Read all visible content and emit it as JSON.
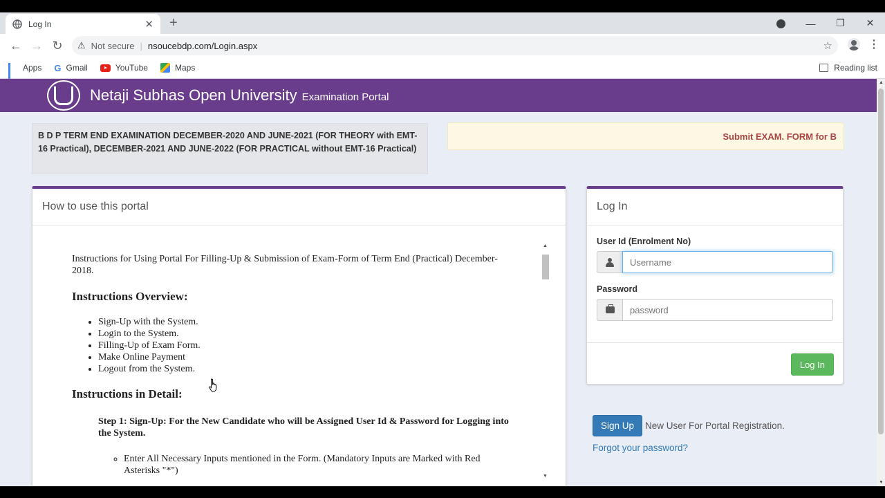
{
  "browser": {
    "tab_title": "Log In",
    "security_label": "Not secure",
    "url": "nsoucebdp.com/Login.aspx",
    "bookmarks": [
      "Apps",
      "Gmail",
      "YouTube",
      "Maps"
    ],
    "reading_list": "Reading list"
  },
  "header": {
    "title": "Netaji Subhas Open University",
    "subtitle": "Examination Portal",
    "brand_color": "#6a3d8c"
  },
  "notices": {
    "left": "B D P TERM END EXAMINATION DECEMBER-2020 AND JUNE-2021 (FOR THEORY with EMT-16 Practical), DECEMBER-2021 AND JUNE-2022 (FOR PRACTICAL without EMT-16 Practical)",
    "right": "Submit EXAM. FORM for B"
  },
  "howto": {
    "title": "How to use this portal",
    "intro": "Instructions for Using Portal For Filling-Up & Submission of Exam-Form of Term End (Practical) December-2018.",
    "overview_heading": "Instructions Overview:",
    "overview_items": [
      "Sign-Up with the System.",
      "Login to the System.",
      "Filling-Up of Exam Form.",
      "Make Online Payment",
      "Logout from the System."
    ],
    "detail_heading": "Instructions in Detail:",
    "step1": "Step 1: Sign-Up: For the New Candidate who will be Assigned User Id & Password for Logging into the System.",
    "step1_items": [
      "Enter All Necessary Inputs mentioned in the Form. (Mandatory Inputs are Marked with Red Asterisks \"*\")"
    ]
  },
  "login": {
    "title": "Log In",
    "user_label": "User Id (Enrolment No)",
    "user_placeholder": "Username",
    "password_label": "Password",
    "password_placeholder": "password",
    "button": "Log In"
  },
  "signup": {
    "button": "Sign Up",
    "text": "New User For Portal Registration.",
    "forgot": "Forgot your password?"
  }
}
